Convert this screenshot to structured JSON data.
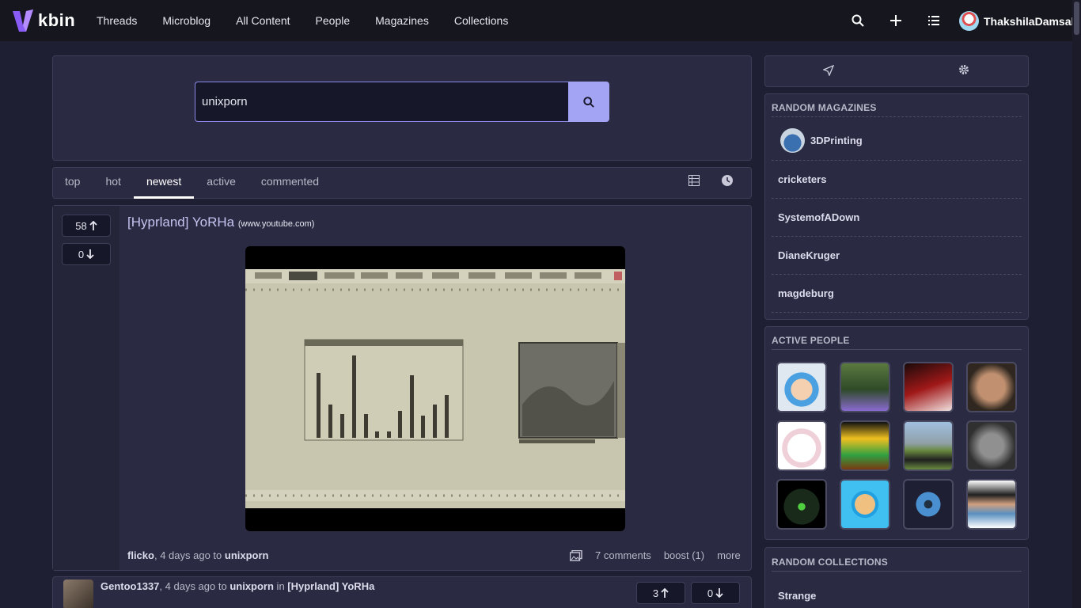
{
  "app": {
    "logo_text": "kbin",
    "brand_color": "#8a5cf6"
  },
  "nav": {
    "items": [
      "Threads",
      "Microblog",
      "All Content",
      "People",
      "Magazines",
      "Collections"
    ]
  },
  "topbar": {
    "icons": [
      "search-icon",
      "plus-icon",
      "list-icon"
    ],
    "username": "ThakshilaDamsak"
  },
  "search": {
    "value": "unixporn",
    "accent": "#a4a4f4"
  },
  "sort": {
    "tabs": [
      "top",
      "hot",
      "newest",
      "active",
      "commented"
    ],
    "active": "newest"
  },
  "entry": {
    "upvotes": "58",
    "downvotes": "0",
    "title": "[Hyprland] YoRHa",
    "domain": "(www.youtube.com)",
    "author": "flicko",
    "time": ", 4 days ago to ",
    "magazine": "unixporn",
    "comments": "7 comments",
    "boost": "boost (1)",
    "more": "more"
  },
  "comment": {
    "author": "Gentoo1337",
    "time": ", 4 days ago to ",
    "magazine": "unixporn",
    "in_text": " in ",
    "thread": "[Hyprland] YoRHa",
    "upvotes": "3",
    "downvotes": "0"
  },
  "sidebar": {
    "random_magazines_title": "RANDOM MAGAZINES",
    "magazines": [
      "3DPrinting",
      "cricketers",
      "SystemofADown",
      "DianeKruger",
      "magdeburg"
    ],
    "active_people_title": "ACTIVE PEOPLE",
    "random_collections_title": "RANDOM COLLECTIONS",
    "collections": [
      "Strange"
    ]
  }
}
